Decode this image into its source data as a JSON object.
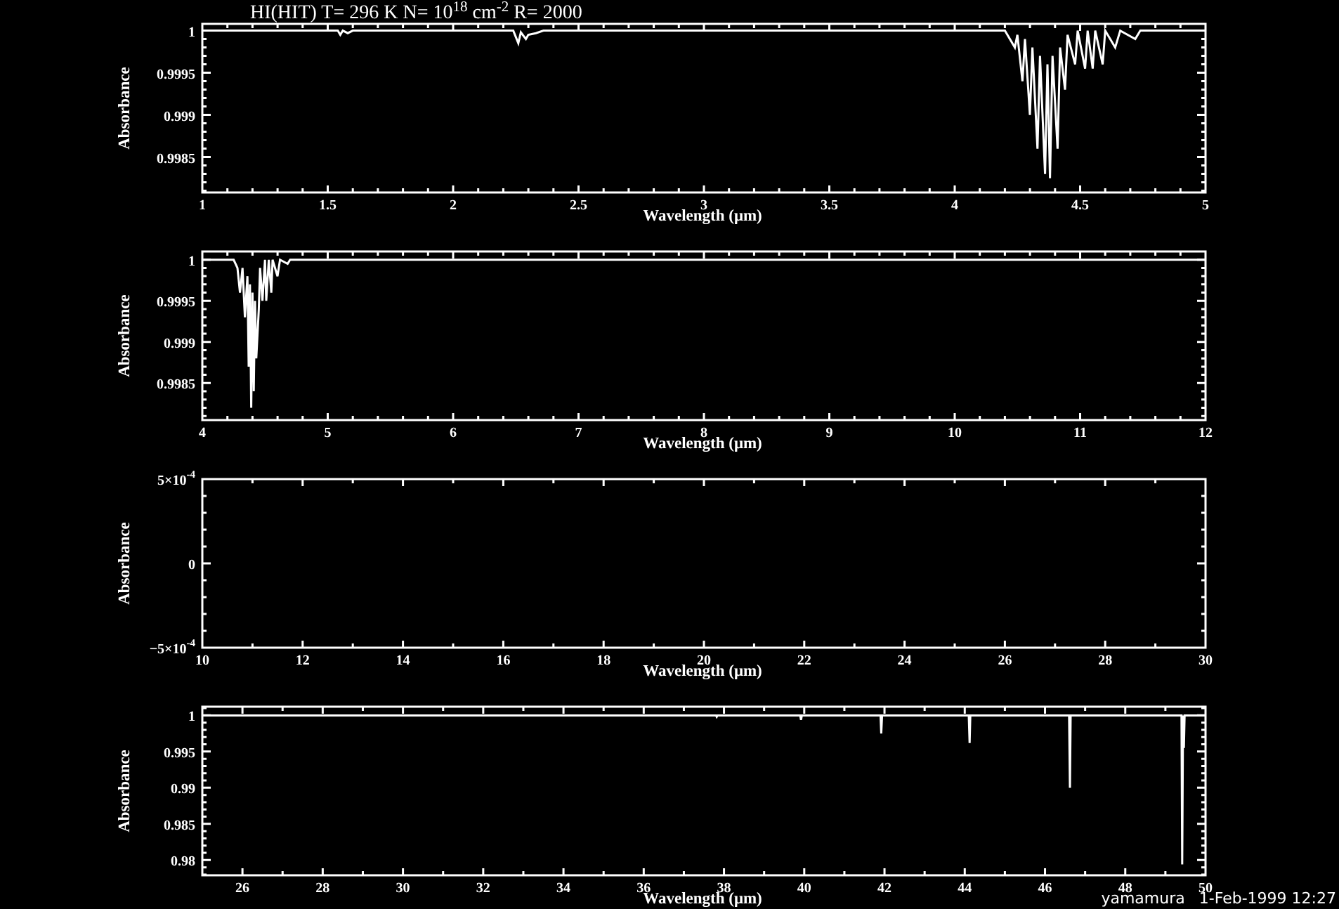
{
  "charts": [
    {
      "chart_data": {
        "type": "line",
        "title": "HI(HIT) T= 296 K N= 10$^{18}$ cm$^{-2}$ R= 2000",
        "xlabel": "Wavelength (μm)",
        "ylabel": "Absorbance",
        "xlim": [
          1,
          5
        ],
        "ylim": [
          0.99808,
          1.00008
        ],
        "xticks": [
          1,
          1.5,
          2,
          2.5,
          3,
          3.5,
          4,
          4.5,
          5
        ],
        "yticks": [
          1,
          0.9995,
          0.999,
          0.9985
        ],
        "x": [
          1,
          1.54,
          1.55,
          1.56,
          1.58,
          1.6,
          2.24,
          2.26,
          2.27,
          2.29,
          2.3,
          2.33,
          2.36,
          4.2,
          4.24,
          4.25,
          4.27,
          4.28,
          4.3,
          4.31,
          4.33,
          4.34,
          4.36,
          4.37,
          4.38,
          4.39,
          4.41,
          4.42,
          4.44,
          4.45,
          4.48,
          4.49,
          4.52,
          4.53,
          4.55,
          4.56,
          4.59,
          4.6,
          4.64,
          4.66,
          4.72,
          4.74,
          5
        ],
        "series": [
          {
            "color": "#ffffff",
            "values": [
              1,
              1,
              0.99995,
              1,
              0.99997,
              1,
              1,
              0.99985,
              0.99998,
              0.9999,
              0.99995,
              0.99997,
              1,
              1,
              0.9998,
              0.99995,
              0.9994,
              0.9999,
              0.999,
              0.9998,
              0.9986,
              0.9997,
              0.9983,
              0.9996,
              0.99825,
              0.9997,
              0.9986,
              0.9998,
              0.9993,
              0.99995,
              0.9996,
              1,
              0.99955,
              1,
              0.99955,
              1,
              0.9996,
              1,
              0.9998,
              1,
              0.9999,
              1,
              1
            ]
          }
        ]
      }
    },
    {
      "chart_data": {
        "type": "line",
        "xlabel": "Wavelength (μm)",
        "ylabel": "Absorbance",
        "xlim": [
          4,
          12
        ],
        "ylim": [
          0.99805,
          1.0001
        ],
        "xticks": [
          4,
          5,
          6,
          7,
          8,
          9,
          10,
          11,
          12
        ],
        "yticks": [
          1,
          0.9995,
          0.999,
          0.9985
        ],
        "x": [
          4,
          4.25,
          4.28,
          4.3,
          4.32,
          4.34,
          4.36,
          4.37,
          4.38,
          4.39,
          4.4,
          4.41,
          4.42,
          4.43,
          4.45,
          4.46,
          4.48,
          4.5,
          4.51,
          4.53,
          4.55,
          4.56,
          4.6,
          4.62,
          4.68,
          4.7,
          4.8,
          12
        ],
        "series": [
          {
            "color": "#ffffff",
            "values": [
              1,
              1,
              0.9999,
              0.9996,
              0.9999,
              0.9993,
              0.9998,
              0.9987,
              0.9997,
              0.9982,
              0.9996,
              0.9984,
              0.9995,
              0.9988,
              0.9994,
              0.9999,
              0.9995,
              1,
              0.9995,
              1,
              0.9996,
              1,
              0.9998,
              1,
              0.99995,
              1,
              1,
              1
            ]
          }
        ]
      }
    },
    {
      "chart_data": {
        "type": "line",
        "xlabel": "Wavelength (μm)",
        "ylabel": "Absorbance",
        "xlim": [
          10,
          30
        ],
        "ylim": [
          -0.0005,
          0.0005
        ],
        "xticks": [
          10,
          12,
          14,
          16,
          18,
          20,
          22,
          24,
          26,
          28,
          30
        ],
        "yticks": [
          {
            "value": 0.0005,
            "label": "5×10$^{-4}$"
          },
          0,
          {
            "value": -0.0005,
            "label": "−5×10$^{-4}$"
          }
        ]
      }
    },
    {
      "chart_data": {
        "type": "line",
        "xlabel": "Wavelength (μm)",
        "ylabel": "Absorbance",
        "xlim": [
          25,
          50
        ],
        "ylim": [
          0.9779,
          1.0012
        ],
        "xticks": [
          26,
          28,
          30,
          32,
          34,
          36,
          38,
          40,
          42,
          44,
          46,
          48,
          50
        ],
        "yticks": [
          1,
          0.995,
          0.99,
          0.985,
          0.98
        ],
        "x": [
          25,
          37.8,
          37.82,
          37.84,
          39.9,
          39.92,
          39.94,
          41.9,
          41.92,
          41.94,
          44.1,
          44.12,
          44.14,
          46.6,
          46.62,
          46.64,
          49.4,
          49.42,
          49.44,
          49.46,
          49.48,
          50
        ],
        "series": [
          {
            "color": "#ffffff",
            "values": [
              1,
              1,
              0.9998,
              1,
              1,
              0.9994,
              1,
              1,
              0.9975,
              1,
              1,
              0.9962,
              1,
              1,
              0.99,
              1,
              1,
              0.9794,
              1,
              0.9955,
              1,
              1
            ]
          }
        ]
      }
    }
  ],
  "footer": {
    "user": "yamamura",
    "timestamp": "1-Feb-1999 12:27"
  }
}
